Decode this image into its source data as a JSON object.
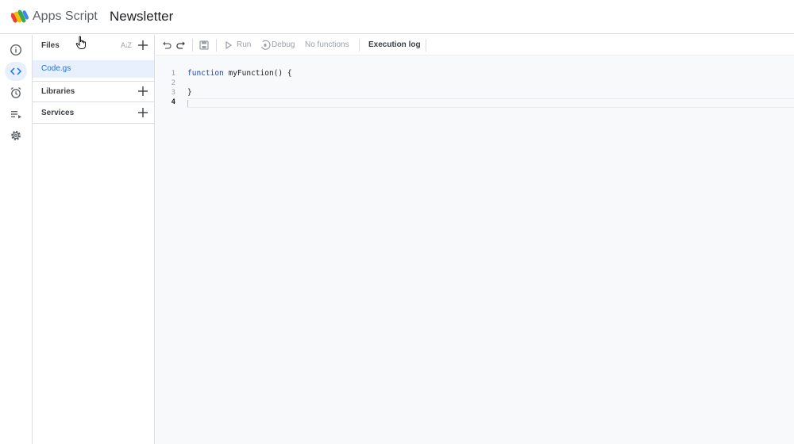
{
  "header": {
    "product_name": "Apps Script",
    "project_title": "Newsletter"
  },
  "rail": {
    "items": [
      {
        "icon": "info-icon",
        "label": "Overview"
      },
      {
        "icon": "code-icon",
        "label": "Editor",
        "active": true
      },
      {
        "icon": "alarm-clock-icon",
        "label": "Triggers"
      },
      {
        "icon": "executions-icon",
        "label": "Executions"
      },
      {
        "icon": "gear-icon",
        "label": "Settings"
      }
    ]
  },
  "files_panel": {
    "files_title": "Files",
    "files": [
      {
        "name": "Code.gs"
      }
    ],
    "libraries_title": "Libraries",
    "services_title": "Services"
  },
  "toolbar": {
    "run_label": "Run",
    "debug_label": "Debug",
    "function_select": "No functions",
    "execution_log_label": "Execution log"
  },
  "editor": {
    "line_numbers": [
      "1",
      "2",
      "3",
      "4"
    ],
    "keyword": "function",
    "line1_rest": " myFunction() {",
    "line3": "}"
  },
  "colors": {
    "accent": "#1a73e8",
    "active_bg": "#e8f0fe",
    "editor_bg": "#f8f9fa"
  }
}
